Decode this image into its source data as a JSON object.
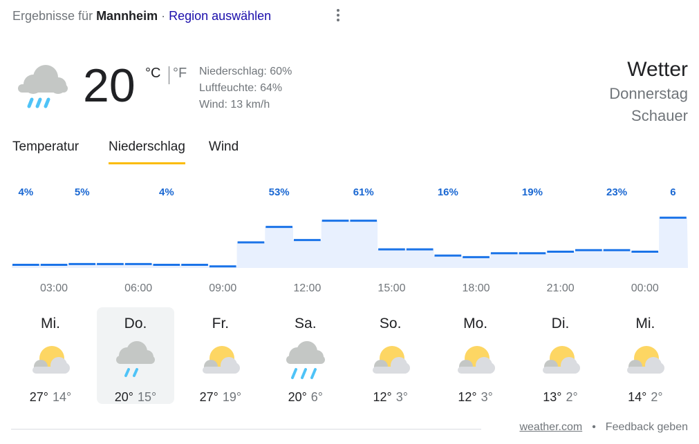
{
  "search": {
    "results_for": "Ergebnisse für",
    "city": "Mannheim",
    "separator": "·",
    "region_link": "Region auswählen"
  },
  "current": {
    "icon": "rain-cloud-icon",
    "temperature": "20",
    "unit_c": "°C",
    "unit_f": "°F",
    "precipitation": "Niederschlag: 60%",
    "humidity": "Luftfeuchte: 64%",
    "wind": "Wind: 13 km/h"
  },
  "header": {
    "title": "Wetter",
    "day": "Donnerstag",
    "condition": "Schauer"
  },
  "tabs": [
    {
      "label": "Temperatur",
      "selected": false
    },
    {
      "label": "Niederschlag",
      "selected": true
    },
    {
      "label": "Wind",
      "selected": false
    }
  ],
  "chart_data": {
    "type": "area",
    "unit": "%",
    "x": [
      "03:00",
      "04:00",
      "05:00",
      "06:00",
      "07:00",
      "08:00",
      "09:00",
      "10:00",
      "11:00",
      "12:00",
      "13:00",
      "14:00",
      "15:00",
      "16:00",
      "17:00",
      "18:00",
      "19:00",
      "20:00",
      "21:00",
      "22:00",
      "23:00",
      "00:00",
      "01:00",
      "02:00"
    ],
    "values": [
      4,
      4,
      5,
      5,
      5,
      4,
      4,
      2,
      33,
      53,
      36,
      61,
      61,
      24,
      24,
      16,
      14,
      19,
      19,
      21,
      23,
      23,
      21,
      65
    ],
    "value_labels": [
      "4%",
      "",
      "5%",
      "",
      "",
      "4%",
      "",
      "",
      "",
      "53%",
      "",
      "",
      "61%",
      "",
      "",
      "16%",
      "",
      "",
      "19%",
      "",
      "",
      "23%",
      "",
      "6"
    ],
    "x_tick_labels": [
      "03:00",
      "06:00",
      "09:00",
      "12:00",
      "15:00",
      "18:00",
      "21:00",
      "00:00"
    ],
    "ylim": [
      0,
      100
    ],
    "line_color": "#1a73e8",
    "fill_color": "#e8f0fe",
    "label_color": "#1967d2"
  },
  "forecast": [
    {
      "day": "Mi.",
      "icon": "partly-cloudy-icon",
      "high": "27°",
      "low": "14°",
      "selected": false
    },
    {
      "day": "Do.",
      "icon": "rain-cloud-icon",
      "high": "20°",
      "low": "15°",
      "selected": true
    },
    {
      "day": "Fr.",
      "icon": "partly-cloudy-icon",
      "high": "27°",
      "low": "19°",
      "selected": false
    },
    {
      "day": "Sa.",
      "icon": "heavy-rain-icon",
      "high": "20°",
      "low": "6°",
      "selected": false
    },
    {
      "day": "So.",
      "icon": "partly-cloudy-icon",
      "high": "12°",
      "low": "3°",
      "selected": false
    },
    {
      "day": "Mo.",
      "icon": "partly-cloudy-icon",
      "high": "12°",
      "low": "3°",
      "selected": false
    },
    {
      "day": "Di.",
      "icon": "partly-cloudy-icon",
      "high": "13°",
      "low": "2°",
      "selected": false
    },
    {
      "day": "Mi.",
      "icon": "partly-cloudy-icon",
      "high": "14°",
      "low": "2°",
      "selected": false
    }
  ],
  "footer": {
    "source": "weather.com",
    "bullet": "•",
    "feedback": "Feedback geben"
  }
}
